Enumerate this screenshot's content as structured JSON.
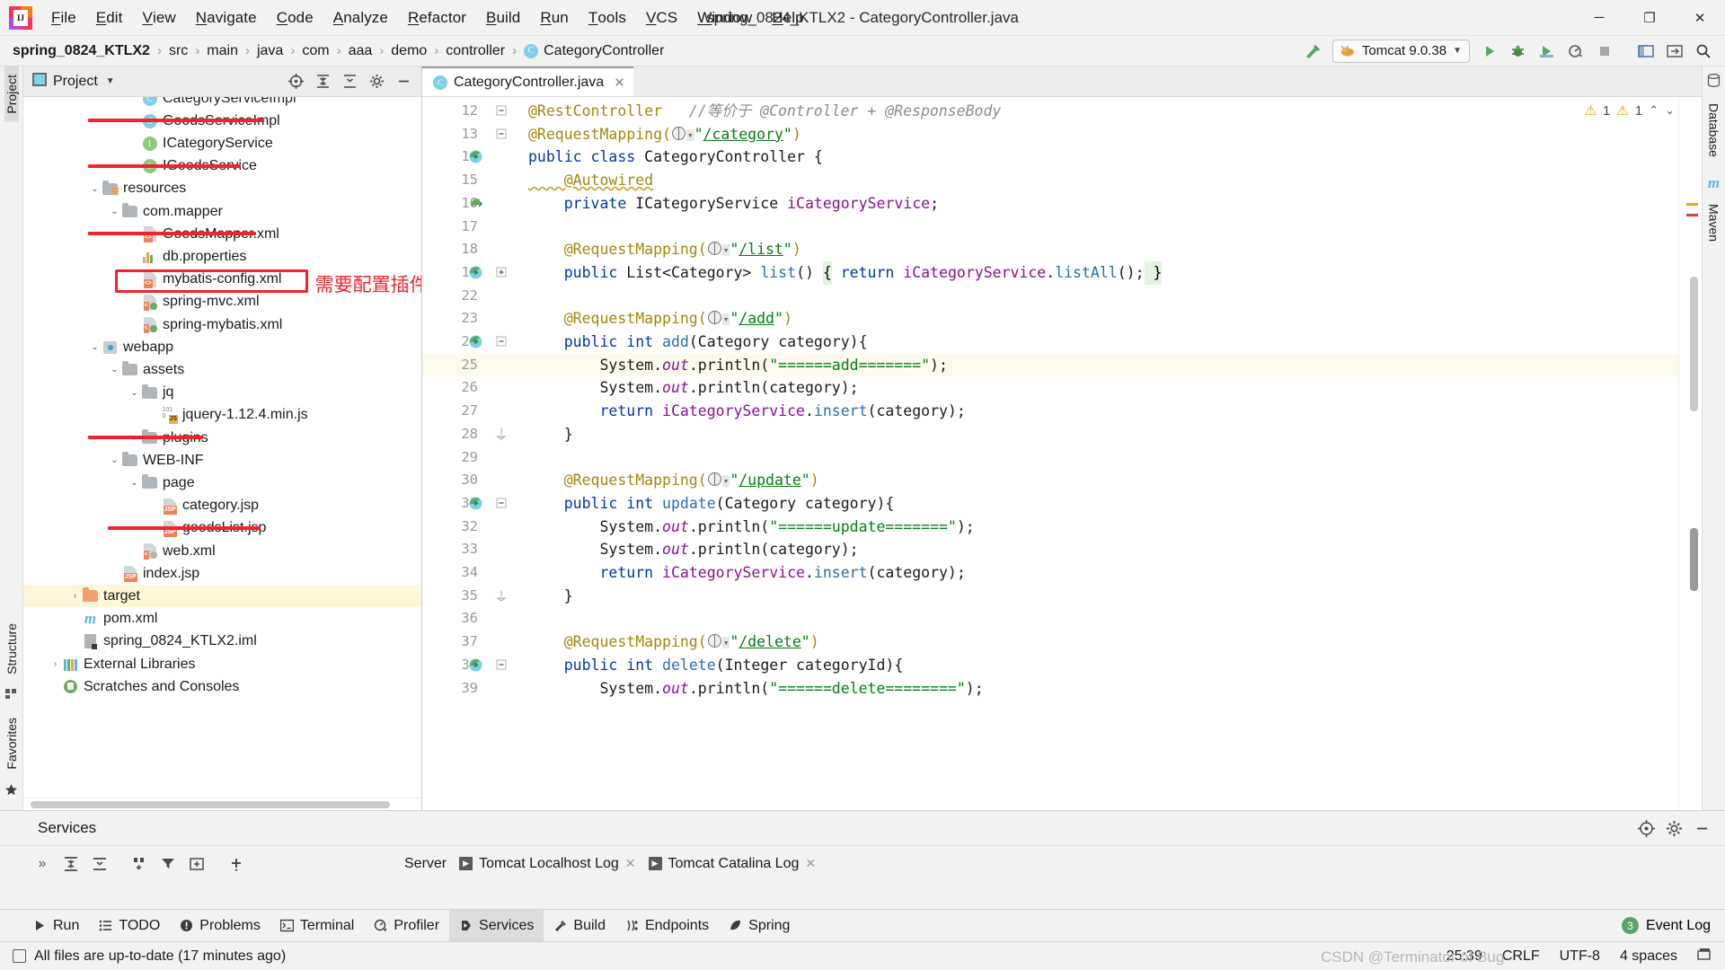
{
  "window": {
    "title": "spring_0824_KTLX2 - CategoryController.java",
    "minimize": "─",
    "maximize": "❐",
    "close": "✕"
  },
  "menu": [
    "File",
    "Edit",
    "View",
    "Navigate",
    "Code",
    "Analyze",
    "Refactor",
    "Build",
    "Run",
    "Tools",
    "VCS",
    "Window",
    "Help"
  ],
  "breadcrumb": {
    "items": [
      "spring_0824_KTLX2",
      "src",
      "main",
      "java",
      "com",
      "aaa",
      "demo",
      "controller",
      "CategoryController"
    ],
    "separator": "›",
    "class_icon_letter": "C"
  },
  "run_config": {
    "label": "Tomcat 9.0.38",
    "chevron": "▼"
  },
  "left_strip": {
    "top": "Project",
    "bottom_structure": "Structure",
    "bottom_favorites": "Favorites"
  },
  "right_strip": {
    "database": "Database",
    "maven": "Maven",
    "maven_icon": "m"
  },
  "project_panel": {
    "title": "Project",
    "chevron": "▼",
    "tree": [
      {
        "label": "CategoryServiceImpl",
        "indent": 5,
        "icon": "class-impl",
        "chev": "",
        "clipped": true
      },
      {
        "label": "GoodsServiceImpl",
        "indent": 5,
        "icon": "class-impl",
        "chev": "",
        "struck": true
      },
      {
        "label": "ICategoryService",
        "indent": 5,
        "icon": "interface",
        "chev": ""
      },
      {
        "label": "IGoodsService",
        "indent": 5,
        "icon": "interface",
        "chev": "",
        "struck": true
      },
      {
        "label": "resources",
        "indent": 3,
        "icon": "folder-res",
        "chev": "⌄"
      },
      {
        "label": "com.mapper",
        "indent": 4,
        "icon": "folder",
        "chev": "⌄"
      },
      {
        "label": "GoodsMapper.xml",
        "indent": 5,
        "icon": "xml",
        "chev": "",
        "struck": true
      },
      {
        "label": "db.properties",
        "indent": 5,
        "icon": "properties",
        "chev": ""
      },
      {
        "label": "mybatis-config.xml",
        "indent": 5,
        "icon": "xml",
        "chev": "",
        "boxed": true
      },
      {
        "label": "spring-mvc.xml",
        "indent": 5,
        "icon": "spring-xml",
        "chev": ""
      },
      {
        "label": "spring-mybatis.xml",
        "indent": 5,
        "icon": "spring-xml",
        "chev": ""
      },
      {
        "label": "webapp",
        "indent": 3,
        "icon": "webapp",
        "chev": "⌄"
      },
      {
        "label": "assets",
        "indent": 4,
        "icon": "folder",
        "chev": "⌄"
      },
      {
        "label": "jq",
        "indent": 5,
        "icon": "folder",
        "chev": "⌄"
      },
      {
        "label": "jquery-1.12.4.min.js",
        "indent": 6,
        "icon": "js",
        "chev": ""
      },
      {
        "label": "plugins",
        "indent": 5,
        "icon": "folder",
        "chev": "›",
        "struck": true
      },
      {
        "label": "WEB-INF",
        "indent": 4,
        "icon": "folder",
        "chev": "⌄"
      },
      {
        "label": "page",
        "indent": 5,
        "icon": "folder",
        "chev": "⌄"
      },
      {
        "label": "category.jsp",
        "indent": 6,
        "icon": "jsp",
        "chev": ""
      },
      {
        "label": "goodsList.jsp",
        "indent": 6,
        "icon": "jsp",
        "chev": "",
        "struck": true
      },
      {
        "label": "web.xml",
        "indent": 5,
        "icon": "web-xml",
        "chev": ""
      },
      {
        "label": "index.jsp",
        "indent": 4,
        "icon": "jsp",
        "chev": ""
      },
      {
        "label": "target",
        "indent": 2,
        "icon": "folder-orange",
        "chev": "›",
        "selected": true
      },
      {
        "label": "pom.xml",
        "indent": 2,
        "icon": "maven",
        "chev": ""
      },
      {
        "label": "spring_0824_KTLX2.iml",
        "indent": 2,
        "icon": "iml",
        "chev": ""
      },
      {
        "label": "External Libraries",
        "indent": 1,
        "icon": "libraries",
        "chev": "›"
      },
      {
        "label": "Scratches and Consoles",
        "indent": 1,
        "icon": "scratches",
        "chev": ""
      }
    ],
    "annotation": "需要配置插件"
  },
  "editor": {
    "tab": {
      "label": "CategoryController.java",
      "close": "✕",
      "icon_letter": "C"
    },
    "inspections": {
      "warn1": "1",
      "warn2": "1",
      "up": "⌃",
      "down": "⌄"
    },
    "lines": [
      {
        "n": "12",
        "gutter": "fold-minus",
        "tokens": [
          {
            "t": "@RestController",
            "c": "anno"
          },
          {
            "t": "   ",
            "c": "plain"
          },
          {
            "t": "//等价于 @Controller + @ResponseBody",
            "c": "cmt"
          }
        ]
      },
      {
        "n": "13",
        "gutter": "fold-minus",
        "tokens": [
          {
            "t": "@RequestMapping(",
            "c": "anno"
          },
          {
            "t": "GLOBE",
            "c": "globe"
          },
          {
            "t": "\"",
            "c": "str"
          },
          {
            "t": "/category",
            "c": "link"
          },
          {
            "t": "\"",
            "c": "str"
          },
          {
            "t": ")",
            "c": "anno"
          }
        ]
      },
      {
        "n": "14",
        "icon": "class-run",
        "tokens": [
          {
            "t": "public class ",
            "c": "kw"
          },
          {
            "t": "CategoryController ",
            "c": "cls"
          },
          {
            "t": "{",
            "c": "plain"
          }
        ]
      },
      {
        "n": "15",
        "tokens": [
          {
            "t": "    @Autowired",
            "c": "anno-wavy"
          }
        ]
      },
      {
        "n": "16",
        "icon": "bean",
        "tokens": [
          {
            "t": "    ",
            "c": "plain"
          },
          {
            "t": "private ",
            "c": "kw"
          },
          {
            "t": "ICategoryService ",
            "c": "cls"
          },
          {
            "t": "iCategoryService",
            "c": "field"
          },
          {
            "t": ";",
            "c": "plain"
          }
        ]
      },
      {
        "n": "17",
        "tokens": []
      },
      {
        "n": "18",
        "tokens": [
          {
            "t": "    @RequestMapping(",
            "c": "anno"
          },
          {
            "t": "GLOBE",
            "c": "globe"
          },
          {
            "t": "\"",
            "c": "str"
          },
          {
            "t": "/list",
            "c": "link"
          },
          {
            "t": "\"",
            "c": "str"
          },
          {
            "t": ")",
            "c": "anno"
          }
        ]
      },
      {
        "n": "19",
        "icon": "class-run",
        "gutter": "fold-plus",
        "tokens": [
          {
            "t": "    ",
            "c": "plain"
          },
          {
            "t": "public ",
            "c": "kw"
          },
          {
            "t": "List<Category> ",
            "c": "cls"
          },
          {
            "t": "list",
            "c": "type"
          },
          {
            "t": "() ",
            "c": "plain"
          },
          {
            "t": "{",
            "c": "brace"
          },
          {
            "t": " ",
            "c": "plain"
          },
          {
            "t": "return ",
            "c": "kw"
          },
          {
            "t": "iCategoryService",
            "c": "field"
          },
          {
            "t": ".",
            "c": "plain"
          },
          {
            "t": "listAll",
            "c": "type"
          },
          {
            "t": "();",
            "c": "plain"
          },
          {
            "t": " }",
            "c": "brace"
          }
        ]
      },
      {
        "n": "22",
        "tokens": []
      },
      {
        "n": "23",
        "tokens": [
          {
            "t": "    @RequestMapping(",
            "c": "anno"
          },
          {
            "t": "GLOBE",
            "c": "globe"
          },
          {
            "t": "\"",
            "c": "str"
          },
          {
            "t": "/add",
            "c": "link"
          },
          {
            "t": "\"",
            "c": "str"
          },
          {
            "t": ")",
            "c": "anno"
          }
        ]
      },
      {
        "n": "24",
        "icon": "class-run",
        "gutter": "fold-minus",
        "tokens": [
          {
            "t": "    ",
            "c": "plain"
          },
          {
            "t": "public ",
            "c": "kw"
          },
          {
            "t": "int ",
            "c": "kw"
          },
          {
            "t": "add",
            "c": "type"
          },
          {
            "t": "(Category category){",
            "c": "plain"
          }
        ]
      },
      {
        "n": "25",
        "hl": true,
        "tokens": [
          {
            "t": "        System.",
            "c": "plain"
          },
          {
            "t": "out",
            "c": "static"
          },
          {
            "t": ".println(",
            "c": "plain"
          },
          {
            "t": "\"======add=======\"",
            "c": "str"
          },
          {
            "t": ");",
            "c": "plain"
          }
        ]
      },
      {
        "n": "26",
        "tokens": [
          {
            "t": "        System.",
            "c": "plain"
          },
          {
            "t": "out",
            "c": "static"
          },
          {
            "t": ".println(category);",
            "c": "plain"
          }
        ]
      },
      {
        "n": "27",
        "tokens": [
          {
            "t": "        ",
            "c": "plain"
          },
          {
            "t": "return ",
            "c": "kw"
          },
          {
            "t": "iCategoryService",
            "c": "field"
          },
          {
            "t": ".",
            "c": "plain"
          },
          {
            "t": "insert",
            "c": "type"
          },
          {
            "t": "(category);",
            "c": "plain"
          }
        ]
      },
      {
        "n": "28",
        "gutter": "fold-end",
        "tokens": [
          {
            "t": "    }",
            "c": "plain"
          }
        ]
      },
      {
        "n": "29",
        "tokens": []
      },
      {
        "n": "30",
        "tokens": [
          {
            "t": "    @RequestMapping(",
            "c": "anno"
          },
          {
            "t": "GLOBE",
            "c": "globe"
          },
          {
            "t": "\"",
            "c": "str"
          },
          {
            "t": "/update",
            "c": "link"
          },
          {
            "t": "\"",
            "c": "str"
          },
          {
            "t": ")",
            "c": "anno"
          }
        ]
      },
      {
        "n": "31",
        "icon": "class-run",
        "gutter": "fold-minus",
        "tokens": [
          {
            "t": "    ",
            "c": "plain"
          },
          {
            "t": "public ",
            "c": "kw"
          },
          {
            "t": "int ",
            "c": "kw"
          },
          {
            "t": "update",
            "c": "type"
          },
          {
            "t": "(Category category){",
            "c": "plain"
          }
        ]
      },
      {
        "n": "32",
        "tokens": [
          {
            "t": "        System.",
            "c": "plain"
          },
          {
            "t": "out",
            "c": "static"
          },
          {
            "t": ".println(",
            "c": "plain"
          },
          {
            "t": "\"======update=======\"",
            "c": "str"
          },
          {
            "t": ");",
            "c": "plain"
          }
        ]
      },
      {
        "n": "33",
        "tokens": [
          {
            "t": "        System.",
            "c": "plain"
          },
          {
            "t": "out",
            "c": "static"
          },
          {
            "t": ".println(category);",
            "c": "plain"
          }
        ]
      },
      {
        "n": "34",
        "tokens": [
          {
            "t": "        ",
            "c": "plain"
          },
          {
            "t": "return ",
            "c": "kw"
          },
          {
            "t": "iCategoryService",
            "c": "field"
          },
          {
            "t": ".",
            "c": "plain"
          },
          {
            "t": "insert",
            "c": "type"
          },
          {
            "t": "(category);",
            "c": "plain"
          }
        ]
      },
      {
        "n": "35",
        "gutter": "fold-end",
        "tokens": [
          {
            "t": "    }",
            "c": "plain"
          }
        ]
      },
      {
        "n": "36",
        "tokens": []
      },
      {
        "n": "37",
        "tokens": [
          {
            "t": "    @RequestMapping(",
            "c": "anno"
          },
          {
            "t": "GLOBE",
            "c": "globe"
          },
          {
            "t": "\"",
            "c": "str"
          },
          {
            "t": "/delete",
            "c": "link"
          },
          {
            "t": "\"",
            "c": "str"
          },
          {
            "t": ")",
            "c": "anno"
          }
        ]
      },
      {
        "n": "38",
        "icon": "class-run",
        "gutter": "fold-minus",
        "tokens": [
          {
            "t": "    ",
            "c": "plain"
          },
          {
            "t": "public ",
            "c": "kw"
          },
          {
            "t": "int ",
            "c": "kw"
          },
          {
            "t": "delete",
            "c": "type"
          },
          {
            "t": "(Integer categoryId){",
            "c": "plain"
          }
        ]
      },
      {
        "n": "39",
        "tokens": [
          {
            "t": "        System.",
            "c": "plain"
          },
          {
            "t": "out",
            "c": "static"
          },
          {
            "t": ".println(",
            "c": "plain"
          },
          {
            "t": "\"======delete========\"",
            "c": "str"
          },
          {
            "t": ");",
            "c": "plain"
          }
        ]
      }
    ]
  },
  "services": {
    "title": "Services",
    "expand_more": "»",
    "server_label": "Server",
    "tabs": [
      {
        "label": "Tomcat Localhost Log",
        "close": "✕"
      },
      {
        "label": "Tomcat Catalina Log",
        "close": "✕"
      }
    ]
  },
  "toolwindows": [
    {
      "label": "Run",
      "icon": "play",
      "selected": false
    },
    {
      "label": "TODO",
      "icon": "list",
      "selected": false
    },
    {
      "label": "Problems",
      "icon": "error",
      "selected": false
    },
    {
      "label": "Terminal",
      "icon": "terminal",
      "selected": false
    },
    {
      "label": "Profiler",
      "icon": "profiler",
      "selected": false
    },
    {
      "label": "Services",
      "icon": "services",
      "selected": true
    },
    {
      "label": "Build",
      "icon": "hammer",
      "selected": false
    },
    {
      "label": "Endpoints",
      "icon": "endpoints",
      "selected": false
    },
    {
      "label": "Spring",
      "icon": "leaf",
      "selected": false
    }
  ],
  "event_log": {
    "label": "Event Log",
    "count": "3"
  },
  "status_bar": {
    "message": "All files are up-to-date (17 minutes ago)",
    "position": "25:39",
    "line_sep": "CRLF",
    "encoding": "UTF-8",
    "indent": "4 spaces",
    "watermark": "CSDN @Terminator of Bug"
  },
  "colors": {
    "accent_red": "#f5222d",
    "keyword_blue": "#0033b3",
    "string_green": "#067d17",
    "annotation_gold": "#9e880d",
    "field_purple": "#871094",
    "selection_yellow": "#fdf6d8"
  }
}
